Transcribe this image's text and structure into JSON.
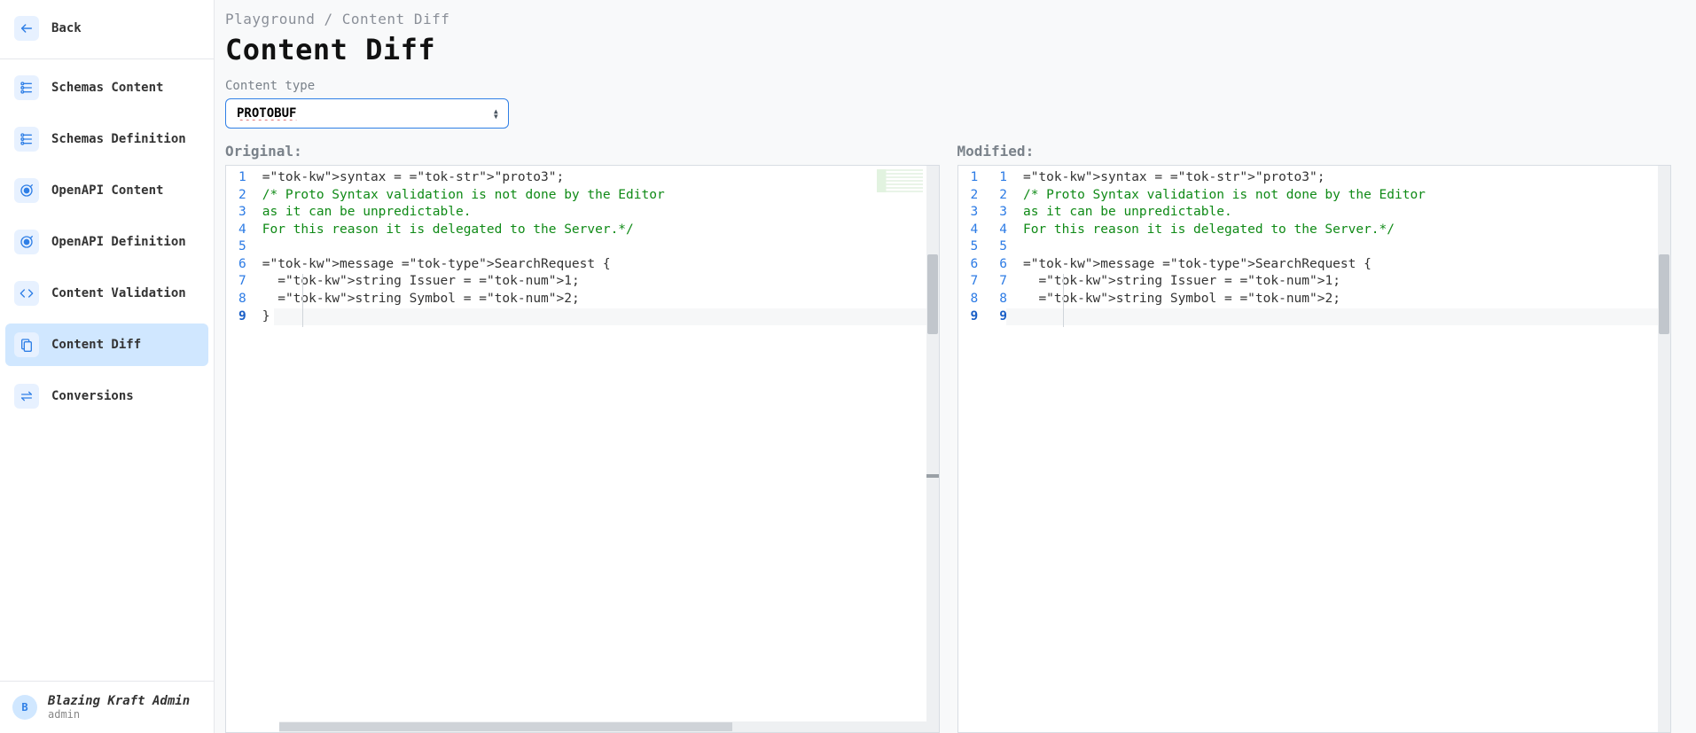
{
  "sidebar": {
    "back_label": "Back",
    "items": [
      {
        "label": "Schemas Content",
        "icon": "schema-icon"
      },
      {
        "label": "Schemas Definition",
        "icon": "schema-icon"
      },
      {
        "label": "OpenAPI Content",
        "icon": "target-icon"
      },
      {
        "label": "OpenAPI Definition",
        "icon": "target-icon"
      },
      {
        "label": "Content Validation",
        "icon": "code-icon"
      },
      {
        "label": "Content Diff",
        "icon": "diff-icon"
      },
      {
        "label": "Conversions",
        "icon": "swap-icon"
      }
    ],
    "active_index": 5
  },
  "breadcrumb": {
    "root": "Playground",
    "sep": "/",
    "leaf": "Content Diff"
  },
  "page_title": "Content Diff",
  "content_type": {
    "label": "Content type",
    "value": "PROTOBUF"
  },
  "diff": {
    "original_label": "Original:",
    "modified_label": "Modified:",
    "line_count": 9,
    "original_lines": [
      "syntax = \"proto3\";",
      "/* Proto Syntax validation is not done by the Editor",
      "as it can be unpredictable.",
      "For this reason it is delegated to the Server.*/",
      "",
      "message SearchRequest {",
      "  string Issuer = 1;",
      "  string Symbol = 2;",
      "}"
    ],
    "modified_lines": [
      "syntax = \"proto3\";",
      "/* Proto Syntax validation is not done by the Editor",
      "as it can be unpredictable.",
      "For this reason it is delegated to the Server.*/",
      "",
      "message SearchRequest {",
      "  string Issuer = 1;",
      "  string Symbol = 2;",
      "}"
    ]
  },
  "user": {
    "initial": "B",
    "name": "Blazing Kraft Admin",
    "sub": "admin"
  }
}
